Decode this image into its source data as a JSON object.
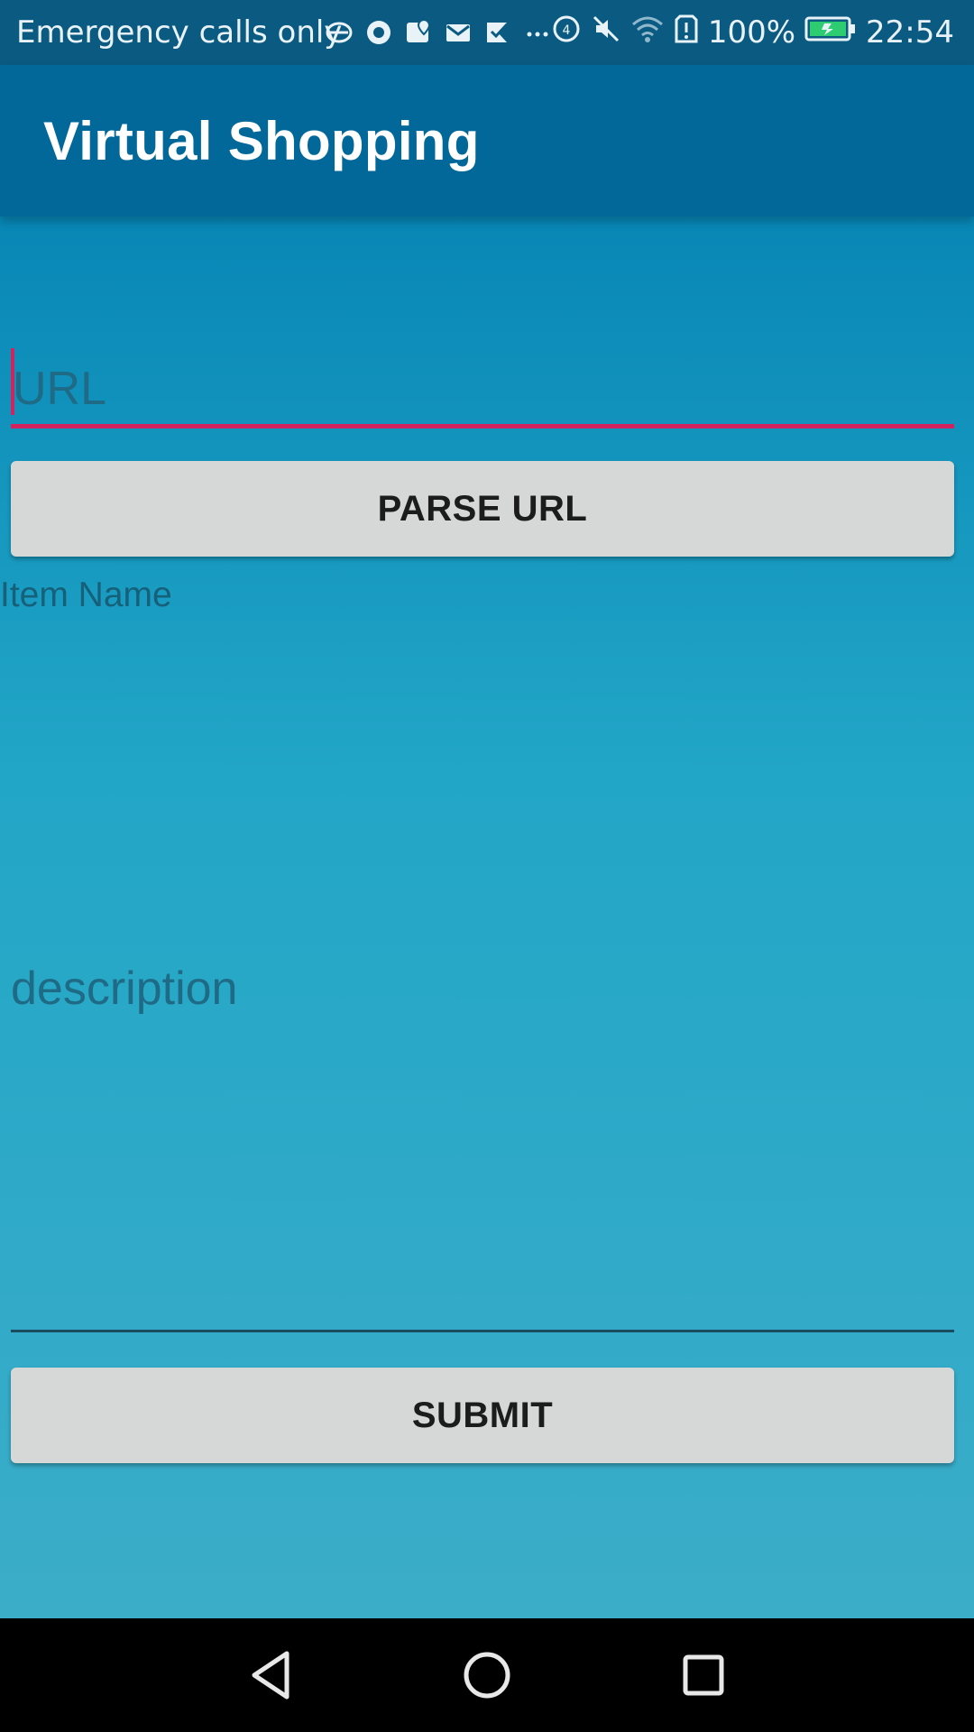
{
  "status_bar": {
    "carrier_text": "Emergency calls only",
    "battery_percent": "100%",
    "time": "22:54",
    "icons": [
      "carrier-glyph-icon",
      "chrome-icon",
      "maps-icon",
      "gmail-icon",
      "tasks-check-icon",
      "more-dots-icon",
      "data-saver-icon",
      "mute-icon",
      "wifi-icon",
      "storage-alert-icon",
      "battery-charging-icon"
    ],
    "battery_color": "#2ecc71"
  },
  "app_bar": {
    "title": "Virtual Shopping",
    "color": "#02689a"
  },
  "form": {
    "url_placeholder": "URL",
    "url_value": "",
    "parse_button_label": "PARSE URL",
    "item_name_label": "Item Name",
    "description_placeholder": "description",
    "description_value": "",
    "submit_button_label": "SUBMIT",
    "accent_color": "#d2235f"
  },
  "nav_bar": {
    "buttons": [
      "back-icon",
      "home-icon",
      "recents-icon"
    ]
  }
}
